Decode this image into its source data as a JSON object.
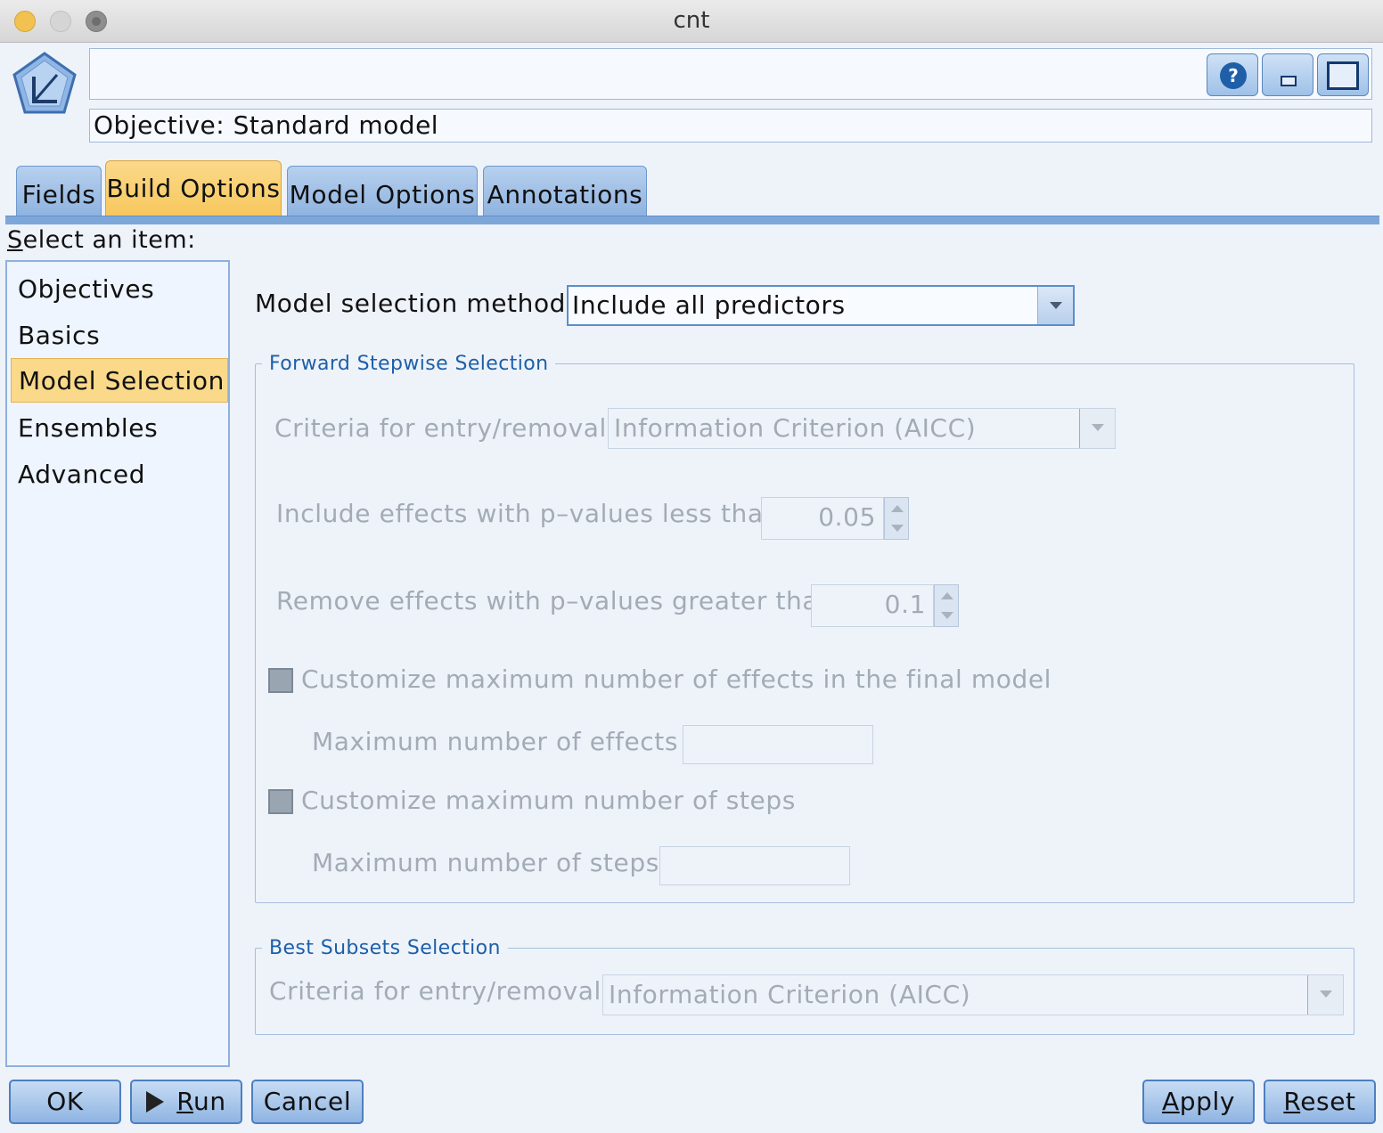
{
  "window": {
    "title": "cnt"
  },
  "header": {
    "name_value": "",
    "objective_text": "Objective: Standard model"
  },
  "header_buttons": {
    "help_icon": "question-mark",
    "minimize_icon": "minimize",
    "maximize_icon": "maximize"
  },
  "tabs": [
    {
      "label": "Fields",
      "active": false
    },
    {
      "label": "Build Options",
      "active": true
    },
    {
      "label": "Model Options",
      "active": false
    },
    {
      "label": "Annotations",
      "active": false
    }
  ],
  "nav": {
    "heading_first": "S",
    "heading_rest": "elect an item:",
    "items": [
      {
        "label": "Objectives",
        "selected": false
      },
      {
        "label": "Basics",
        "selected": false
      },
      {
        "label": "Model Selection",
        "selected": true
      },
      {
        "label": "Ensembles",
        "selected": false
      },
      {
        "label": "Advanced",
        "selected": false
      }
    ]
  },
  "main": {
    "method_label": "Model selection method:",
    "method_value": "Include all predictors",
    "forward": {
      "legend": "Forward Stepwise Selection",
      "criteria_label": "Criteria for entry/removal:",
      "criteria_value": "Information Criterion (AICC)",
      "include_label": "Include effects with p–values less than:",
      "include_value": "0.05",
      "remove_label": "Remove effects with p–values greater than:",
      "remove_value": "0.1",
      "custom_effects_label": "Customize maximum number of effects in the final model",
      "custom_effects_checked": false,
      "max_effects_label": "Maximum number of effects :",
      "max_effects_value": "",
      "custom_steps_label": "Customize maximum number of steps",
      "custom_steps_checked": false,
      "max_steps_label": "Maximum number of steps:",
      "max_steps_value": ""
    },
    "best": {
      "legend": "Best Subsets Selection",
      "criteria_label": "Criteria for entry/removal:",
      "criteria_value": "Information Criterion (AICC)"
    }
  },
  "buttons": {
    "ok": "OK",
    "run": "Run",
    "run_mn": "R",
    "run_rest": "un",
    "cancel": "Cancel",
    "apply_mn": "A",
    "apply_rest": "pply",
    "reset_mn": "R",
    "reset_rest": "eset"
  },
  "colors": {
    "accent": "#fbd98a",
    "tab_blue": "#8fb3e0",
    "disabled_text": "#a3abb5",
    "legend_text": "#1d5fa8"
  }
}
